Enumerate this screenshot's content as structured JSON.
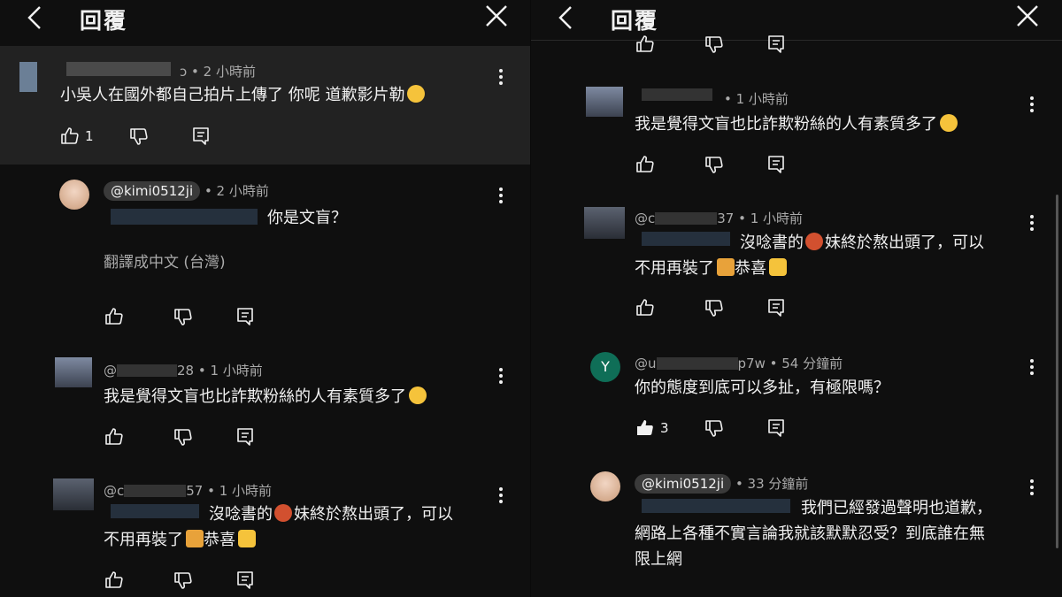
{
  "header": {
    "title": "回覆"
  },
  "left": {
    "top_comment": {
      "handle_suffix": "ɔ",
      "time": "• 2 小時前",
      "text": "小吳人在國外都自己拍片上傳了 你呢 道歉影片勒",
      "likes": "1"
    },
    "reply1": {
      "handle": "@kimi0512ji",
      "time": "• 2 小時前",
      "text": "你是文盲？",
      "translate": "翻譯成中文 (台灣)"
    },
    "reply2": {
      "handle": "@",
      "handle_tail": "28",
      "time": "• 1 小時前",
      "text": "我是覺得文盲也比詐欺粉絲的人有素質多了"
    },
    "reply3": {
      "handle": "@c",
      "handle_tail": "57",
      "time": "• 1 小時前",
      "line1": "沒唸書的",
      "line1b": "妹終於熬出頭了，可以",
      "line2": "不用再裝了",
      "line2b": "恭喜"
    }
  },
  "right": {
    "reply1": {
      "time": "• 1 小時前",
      "text": "我是覺得文盲也比詐欺粉絲的人有素質多了"
    },
    "reply2": {
      "handle": "@c",
      "handle_tail": "37",
      "time": "• 1 小時前",
      "line1": "沒唸書的",
      "line1b": "妹終於熬出頭了，可以",
      "line2": "不用再裝了",
      "line2b": "恭喜"
    },
    "reply3": {
      "avatar_letter": "Y",
      "handle": "@u",
      "handle_tail": "p7w",
      "time": "• 54 分鐘前",
      "text": "你的態度到底可以多扯，有極限嗎？",
      "likes": "3"
    },
    "reply4": {
      "handle": "@kimi0512ji",
      "time": "• 33 分鐘前",
      "line1": "我們已經發過聲明也道歉，",
      "line2": "網路上各種不實言論我就該默默忍受？到底誰在無",
      "line3": "限上網"
    }
  },
  "colors": {
    "bg": "#0f0f0f",
    "highlight": "#222222",
    "avatar_green": "#0f6e57"
  }
}
